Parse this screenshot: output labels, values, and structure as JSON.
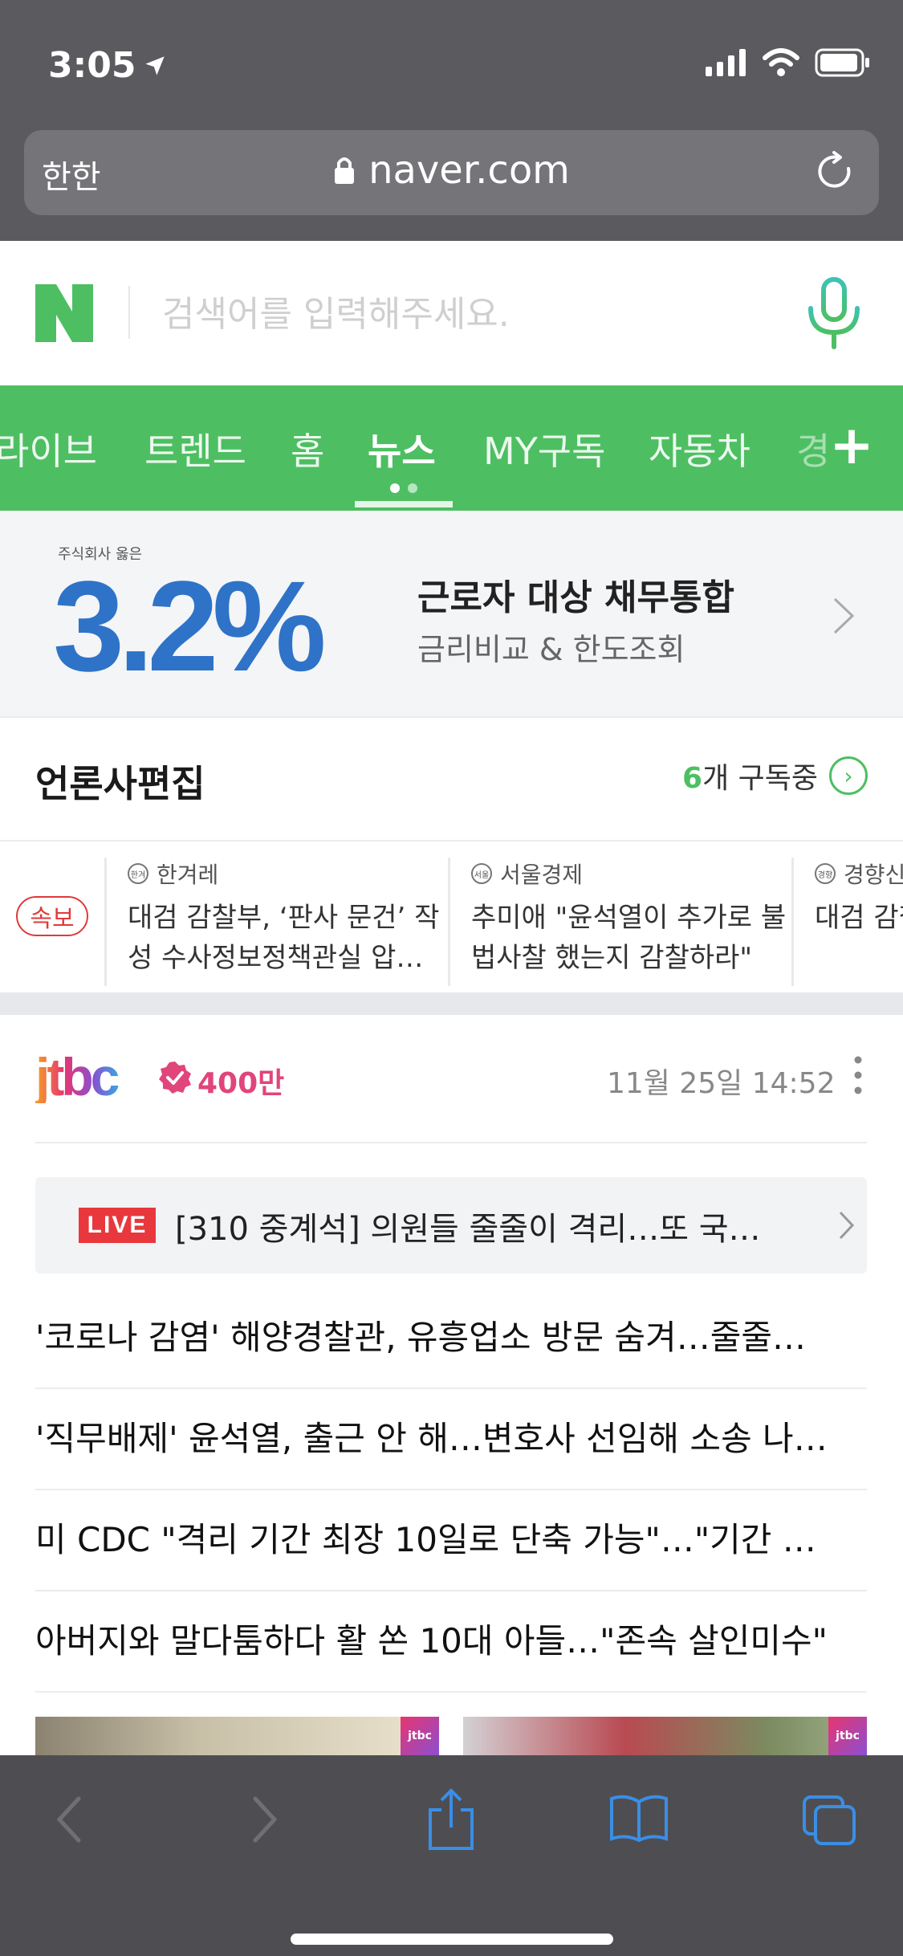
{
  "status": {
    "time": "3:05"
  },
  "address": {
    "aa": "한한",
    "url": "naver.com"
  },
  "search": {
    "placeholder": "검색어를 입력해주세요."
  },
  "tabs": [
    "라이브",
    "트렌드",
    "홈",
    "뉴스",
    "MY구독",
    "자동차",
    "경"
  ],
  "active_tab": "뉴스",
  "ad": {
    "small_text": "주식회사 옳은",
    "rate": "3.2%",
    "title": "근로자 대상 채무통합",
    "subtitle": "금리비교 & 한도조회"
  },
  "press": {
    "title": "언론사편집",
    "subscribe_count": "6",
    "subscribe_label": "개 구독중"
  },
  "ticker": {
    "badge": "속보",
    "items": [
      {
        "source": "한겨레",
        "logo_text": "한겨레",
        "headline": "대검 감찰부, ‘판사 문건’ 작성 수사정보정책관실 압…"
      },
      {
        "source": "서울경제",
        "logo_text": "서울경제",
        "headline": "추미애 \"윤석열이 추가로 불법사찰 했는지 감찰하라\""
      },
      {
        "source": "경향신",
        "logo_text": "경향신문",
        "headline": "대검 감찰 혹’ 수사"
      }
    ]
  },
  "card": {
    "brand": "jtbc",
    "subscribers": "400만",
    "time": "11월 25일 14:52",
    "live_badge": "LIVE",
    "live_text": "[310 중계석] 의원들 줄줄이 격리…또 국…",
    "headlines": [
      "'코로나 감염' 해양경찰관, 유흥업소 방문 숨겨…줄줄…",
      "'직무배제' 윤석열, 출근 안 해…변호사 선임해 소송 나…",
      "미 CDC \"격리 기간 최장 10일로 단축 가능\"…\"기간 …",
      "아버지와 말다툼하다 활 쏜 10대 아들…\"존속 살인미수\""
    ],
    "thumb_badge": "jtbc"
  },
  "colors": {
    "naver_green": "#4dbf62",
    "safari_gray": "#5a5a5f",
    "jtbc_pink": "#e0457b",
    "live_red": "#e8383d"
  }
}
